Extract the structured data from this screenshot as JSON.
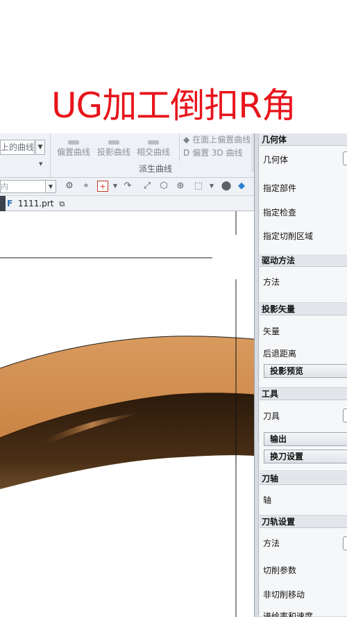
{
  "overlay_title": "UG加工倒扣R角",
  "ribbon": {
    "left_combo_text": "上的曲线",
    "buttons": [
      "偏置曲线",
      "投影曲线",
      "相交曲线"
    ],
    "group_label": "派生曲线",
    "right_items": [
      "在面上偏置曲线",
      "偏置 3D 曲线"
    ]
  },
  "toolbar2": {
    "combo_text": "内"
  },
  "tab": {
    "file_name": "1111.prt"
  },
  "panel": {
    "sections": [
      {
        "header": "几何体",
        "rows": [
          "几何体",
          "指定部件",
          "指定检查",
          "指定切削区域"
        ]
      },
      {
        "header": "驱动方法",
        "rows": [
          "方法"
        ]
      },
      {
        "header": "投影矢量",
        "rows": [
          "矢量",
          "后退距离"
        ],
        "buttons": [
          "投影预览"
        ]
      },
      {
        "header": "工具",
        "rows": [
          "刀具"
        ],
        "buttons": [
          "输出",
          "换刀设置"
        ]
      },
      {
        "header": "刀轴",
        "rows": [
          "轴"
        ]
      },
      {
        "header": "刀轨设置",
        "rows": [
          "方法",
          "切削参数",
          "非切削移动",
          "进给率和速度"
        ]
      }
    ]
  },
  "colors": {
    "title_red": "#e8141b",
    "part_tan": "#d4935a",
    "part_dark": "#3a2410"
  }
}
